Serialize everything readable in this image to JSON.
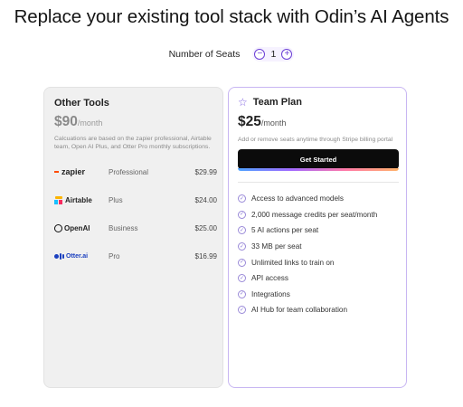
{
  "headline": "Replace your existing tool stack with Odin’s AI Agents",
  "seats": {
    "label": "Number of Seats",
    "minus": "−",
    "plus": "+",
    "count": "1"
  },
  "other_tools": {
    "title": "Other Tools",
    "price": "$90",
    "unit": "/month",
    "note": "Calcuations are based on the  zapier professional, Airtable team, Open AI Plus, and Otter Pro monthly subscriptions.",
    "tools": [
      {
        "logo": "zapier",
        "plan": "Professional",
        "price": "$29.99"
      },
      {
        "logo": "Airtable",
        "plan": "Plus",
        "price": "$24.00"
      },
      {
        "logo": "OpenAI",
        "plan": "Business",
        "price": "$25.00"
      },
      {
        "logo": "Otter.ai",
        "plan": "Pro",
        "price": "$16.99"
      }
    ]
  },
  "team_plan": {
    "title": "Team Plan",
    "icon": "star-icon",
    "price": "$25",
    "unit": "/month",
    "note": "Add or remove seats anytime through Stripe billing portal",
    "cta": "Get Started",
    "features": [
      "Access to advanced models",
      "2,000 message credits per seat/month",
      "5 AI actions per seat",
      "33 MB per seat",
      "Unlimited links to train on",
      "API access",
      "Integrations",
      "AI Hub for team collaboration"
    ]
  },
  "colors": {
    "accent": "#6b3fd6",
    "card_border": "#c8b6f2",
    "cta_bg": "#0b0b0b",
    "zapier": "#ff4a00",
    "otter": "#1a3fbf"
  }
}
